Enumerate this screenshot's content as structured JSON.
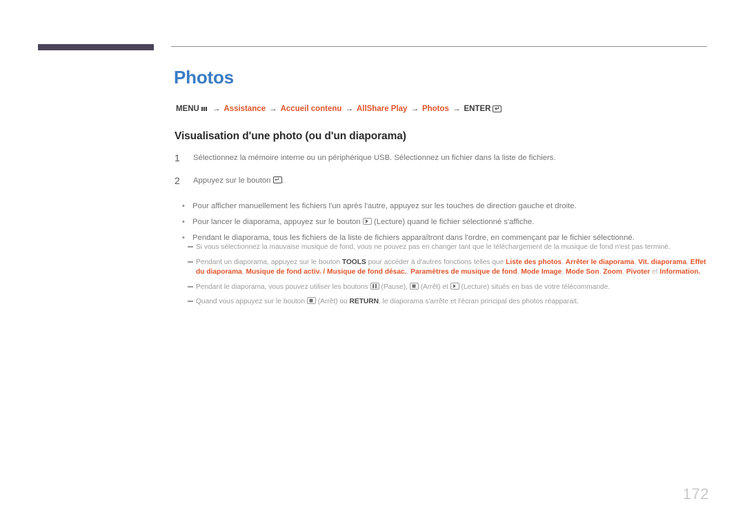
{
  "document": {
    "page_number": "172",
    "title": "Photos",
    "title_color": "#3a7cc4",
    "accent_color": "#e0552b",
    "corner_bar_color": "#4a4458"
  },
  "breadcrumb": {
    "menu_label": "MENU",
    "menu_icon": "menu-bars-icon",
    "arrow": "→",
    "items": [
      {
        "label": "Assistance",
        "accent": true
      },
      {
        "label": "Accueil contenu",
        "accent": true
      },
      {
        "label": "AllShare Play",
        "accent": true
      },
      {
        "label": "Photos",
        "accent": true
      }
    ],
    "enter_label": "ENTER",
    "enter_icon": "enter-return-icon"
  },
  "section": {
    "heading": "Visualisation d'une photo (ou d'un diaporama)",
    "steps": [
      {
        "number": "1",
        "text": "Sélectionnez la mémoire interne ou un périphérique USB. Sélectionnez un fichier dans la liste de fichiers."
      },
      {
        "number": "2",
        "prefix": "Appuyez sur le bouton ",
        "icon": "enter-return-icon",
        "suffix": "."
      }
    ],
    "bullets": [
      {
        "marker": "•",
        "text": "Pour afficher manuellement les fichiers l'un après l'autre, appuyez sur les touches de direction gauche et droite."
      },
      {
        "marker": "•",
        "prefix": "Pour lancer le diaporama, appuyez sur le bouton ",
        "icon": "play-icon",
        "suffix": " (Lecture) quand le fichier sélectionné s'affiche."
      },
      {
        "marker": "•",
        "text": "Pendant le diaporama, tous les fichiers de la liste de fichiers apparaîtront dans l'ordre, en commençant par le fichier sélectionné."
      }
    ],
    "subnotes": [
      {
        "id": "note-bgm-download",
        "text": "Si vous sélectionnez la mauvaise musique de fond, vous ne pouvez pas en changer tant que le téléchargement de la musique de fond n'est pas terminé."
      },
      {
        "id": "note-tools",
        "lead": "Pendant un diaporama, appuyez sur le bouton ",
        "tools_label": "TOOLS",
        "mid": " pour accéder à d'autres fonctions telles que ",
        "options": [
          "Liste des photos",
          "Arrêter le diaporama",
          "Vit. diaporama",
          "Effet du diaporama",
          "Musique de fond activ. / Musique de fond désac.",
          "Paramètres de musique de fond",
          "Mode Image",
          "Mode Son",
          "Zoom",
          "Pivoter"
        ],
        "conjunction": " et ",
        "last_option": "Information",
        "end": "."
      },
      {
        "id": "note-playback-buttons",
        "lead": "Pendant le diaporama, vous pouvez utiliser les boutons ",
        "pause_icon": "pause-icon",
        "pause_label": " (Pause), ",
        "stop_icon": "stop-icon",
        "stop_label": " (Arrêt) et ",
        "play_icon": "play-icon",
        "play_label": " (Lecture) situés en bas de votre télécommande."
      },
      {
        "id": "note-return",
        "lead": "Quand vous appuyez sur le bouton ",
        "stop_icon": "stop-icon",
        "mid": " (Arrêt) ou ",
        "return_label": "RETURN",
        "end": ", le diaporama s'arrête et l'écran principal des photos réapparait."
      }
    ]
  }
}
